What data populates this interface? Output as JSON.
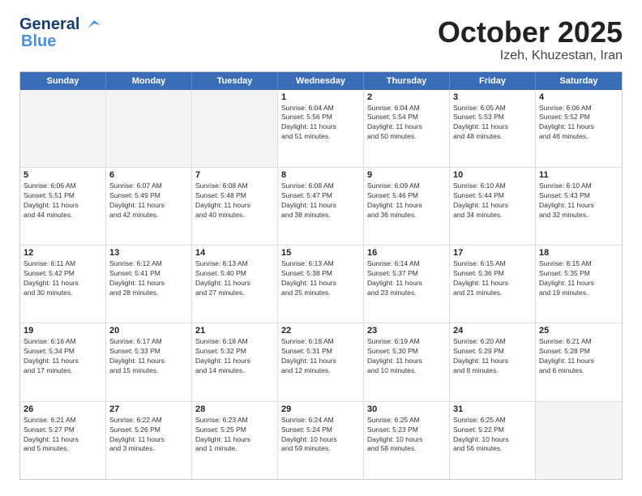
{
  "header": {
    "logo_line1": "General",
    "logo_line2": "Blue",
    "title": "October 2025",
    "subtitle": "Izeh, Khuzestan, Iran"
  },
  "weekdays": [
    "Sunday",
    "Monday",
    "Tuesday",
    "Wednesday",
    "Thursday",
    "Friday",
    "Saturday"
  ],
  "rows": [
    [
      {
        "day": "",
        "text": "",
        "empty": true
      },
      {
        "day": "",
        "text": "",
        "empty": true
      },
      {
        "day": "",
        "text": "",
        "empty": true
      },
      {
        "day": "1",
        "text": "Sunrise: 6:04 AM\nSunset: 5:56 PM\nDaylight: 11 hours\nand 51 minutes."
      },
      {
        "day": "2",
        "text": "Sunrise: 6:04 AM\nSunset: 5:54 PM\nDaylight: 11 hours\nand 50 minutes."
      },
      {
        "day": "3",
        "text": "Sunrise: 6:05 AM\nSunset: 5:53 PM\nDaylight: 11 hours\nand 48 minutes."
      },
      {
        "day": "4",
        "text": "Sunrise: 6:06 AM\nSunset: 5:52 PM\nDaylight: 11 hours\nand 46 minutes."
      }
    ],
    [
      {
        "day": "5",
        "text": "Sunrise: 6:06 AM\nSunset: 5:51 PM\nDaylight: 11 hours\nand 44 minutes."
      },
      {
        "day": "6",
        "text": "Sunrise: 6:07 AM\nSunset: 5:49 PM\nDaylight: 11 hours\nand 42 minutes."
      },
      {
        "day": "7",
        "text": "Sunrise: 6:08 AM\nSunset: 5:48 PM\nDaylight: 11 hours\nand 40 minutes."
      },
      {
        "day": "8",
        "text": "Sunrise: 6:08 AM\nSunset: 5:47 PM\nDaylight: 11 hours\nand 38 minutes."
      },
      {
        "day": "9",
        "text": "Sunrise: 6:09 AM\nSunset: 5:46 PM\nDaylight: 11 hours\nand 36 minutes."
      },
      {
        "day": "10",
        "text": "Sunrise: 6:10 AM\nSunset: 5:44 PM\nDaylight: 11 hours\nand 34 minutes."
      },
      {
        "day": "11",
        "text": "Sunrise: 6:10 AM\nSunset: 5:43 PM\nDaylight: 11 hours\nand 32 minutes."
      }
    ],
    [
      {
        "day": "12",
        "text": "Sunrise: 6:11 AM\nSunset: 5:42 PM\nDaylight: 11 hours\nand 30 minutes."
      },
      {
        "day": "13",
        "text": "Sunrise: 6:12 AM\nSunset: 5:41 PM\nDaylight: 11 hours\nand 28 minutes."
      },
      {
        "day": "14",
        "text": "Sunrise: 6:13 AM\nSunset: 5:40 PM\nDaylight: 11 hours\nand 27 minutes."
      },
      {
        "day": "15",
        "text": "Sunrise: 6:13 AM\nSunset: 5:38 PM\nDaylight: 11 hours\nand 25 minutes."
      },
      {
        "day": "16",
        "text": "Sunrise: 6:14 AM\nSunset: 5:37 PM\nDaylight: 11 hours\nand 23 minutes."
      },
      {
        "day": "17",
        "text": "Sunrise: 6:15 AM\nSunset: 5:36 PM\nDaylight: 11 hours\nand 21 minutes."
      },
      {
        "day": "18",
        "text": "Sunrise: 6:15 AM\nSunset: 5:35 PM\nDaylight: 11 hours\nand 19 minutes."
      }
    ],
    [
      {
        "day": "19",
        "text": "Sunrise: 6:16 AM\nSunset: 5:34 PM\nDaylight: 11 hours\nand 17 minutes."
      },
      {
        "day": "20",
        "text": "Sunrise: 6:17 AM\nSunset: 5:33 PM\nDaylight: 11 hours\nand 15 minutes."
      },
      {
        "day": "21",
        "text": "Sunrise: 6:18 AM\nSunset: 5:32 PM\nDaylight: 11 hours\nand 14 minutes."
      },
      {
        "day": "22",
        "text": "Sunrise: 6:18 AM\nSunset: 5:31 PM\nDaylight: 11 hours\nand 12 minutes."
      },
      {
        "day": "23",
        "text": "Sunrise: 6:19 AM\nSunset: 5:30 PM\nDaylight: 11 hours\nand 10 minutes."
      },
      {
        "day": "24",
        "text": "Sunrise: 6:20 AM\nSunset: 5:29 PM\nDaylight: 11 hours\nand 8 minutes."
      },
      {
        "day": "25",
        "text": "Sunrise: 6:21 AM\nSunset: 5:28 PM\nDaylight: 11 hours\nand 6 minutes."
      }
    ],
    [
      {
        "day": "26",
        "text": "Sunrise: 6:21 AM\nSunset: 5:27 PM\nDaylight: 11 hours\nand 5 minutes."
      },
      {
        "day": "27",
        "text": "Sunrise: 6:22 AM\nSunset: 5:26 PM\nDaylight: 11 hours\nand 3 minutes."
      },
      {
        "day": "28",
        "text": "Sunrise: 6:23 AM\nSunset: 5:25 PM\nDaylight: 11 hours\nand 1 minute."
      },
      {
        "day": "29",
        "text": "Sunrise: 6:24 AM\nSunset: 5:24 PM\nDaylight: 10 hours\nand 59 minutes."
      },
      {
        "day": "30",
        "text": "Sunrise: 6:25 AM\nSunset: 5:23 PM\nDaylight: 10 hours\nand 58 minutes."
      },
      {
        "day": "31",
        "text": "Sunrise: 6:25 AM\nSunset: 5:22 PM\nDaylight: 10 hours\nand 56 minutes."
      },
      {
        "day": "",
        "text": "",
        "empty": true
      }
    ]
  ]
}
